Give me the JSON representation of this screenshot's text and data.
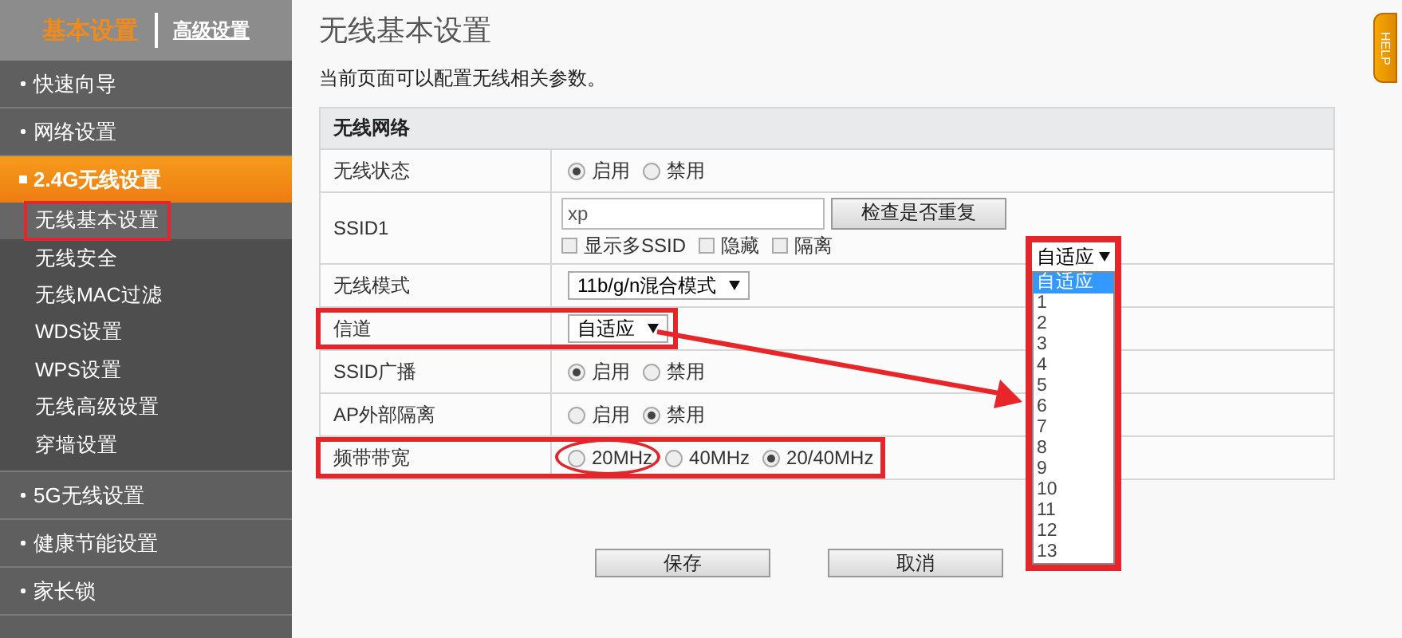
{
  "sidebar": {
    "tabs": [
      {
        "label": "基本设置",
        "selected": true
      },
      {
        "label": "高级设置",
        "selected": false
      }
    ],
    "items": [
      {
        "label": "快速向导",
        "expanded": false
      },
      {
        "label": "网络设置",
        "expanded": false
      },
      {
        "label": "2.4G无线设置",
        "expanded": true,
        "children": [
          {
            "label": "无线基本设置",
            "selected": true
          },
          {
            "label": "无线安全",
            "selected": false
          },
          {
            "label": "无线MAC过滤",
            "selected": false
          },
          {
            "label": "WDS设置",
            "selected": false
          },
          {
            "label": "WPS设置",
            "selected": false
          },
          {
            "label": "无线高级设置",
            "selected": false
          },
          {
            "label": "穿墙设置",
            "selected": false
          }
        ]
      },
      {
        "label": "5G无线设置",
        "expanded": false
      },
      {
        "label": "健康节能设置",
        "expanded": false
      },
      {
        "label": "家长锁",
        "expanded": false
      }
    ]
  },
  "page": {
    "title": "无线基本设置",
    "description": "当前页面可以配置无线相关参数。"
  },
  "form": {
    "section": "无线网络",
    "rows": [
      {
        "label": "无线状态",
        "kind": "radio",
        "highlighted": false,
        "options": [
          {
            "label": "启用",
            "selected": true
          },
          {
            "label": "禁用",
            "selected": false
          }
        ]
      },
      {
        "label": "SSID1",
        "kind": "ssid",
        "highlighted": false,
        "value": "xp",
        "button": "检查是否重复",
        "checkboxes": [
          {
            "label": "显示多SSID",
            "checked": false
          },
          {
            "label": "隐藏",
            "checked": false
          },
          {
            "label": "隔离",
            "checked": false
          }
        ]
      },
      {
        "label": "无线模式",
        "kind": "select",
        "highlighted": false,
        "value": "11b/g/n混合模式"
      },
      {
        "label": "信道",
        "kind": "select",
        "highlighted": true,
        "value": "自适应"
      },
      {
        "label": "SSID广播",
        "kind": "radio",
        "highlighted": false,
        "options": [
          {
            "label": "启用",
            "selected": true
          },
          {
            "label": "禁用",
            "selected": false
          }
        ]
      },
      {
        "label": "AP外部隔离",
        "kind": "radio",
        "highlighted": false,
        "options": [
          {
            "label": "启用",
            "selected": false
          },
          {
            "label": "禁用",
            "selected": true
          }
        ]
      },
      {
        "label": "频带带宽",
        "kind": "radio",
        "highlighted": true,
        "options": [
          {
            "label": "20MHz",
            "selected": false,
            "circled": true
          },
          {
            "label": "40MHz",
            "selected": false,
            "circled": false
          },
          {
            "label": "20/40MHz",
            "selected": true,
            "circled": false
          }
        ]
      }
    ]
  },
  "buttons": [
    "保存",
    "取消"
  ],
  "channel_dropdown": {
    "value": "自适应",
    "options": [
      {
        "label": "自适应",
        "selected": true
      },
      {
        "label": "1",
        "selected": false
      },
      {
        "label": "2",
        "selected": false
      },
      {
        "label": "3",
        "selected": false
      },
      {
        "label": "4",
        "selected": false
      },
      {
        "label": "5",
        "selected": false
      },
      {
        "label": "6",
        "selected": false
      },
      {
        "label": "7",
        "selected": false
      },
      {
        "label": "8",
        "selected": false
      },
      {
        "label": "9",
        "selected": false
      },
      {
        "label": "10",
        "selected": false
      },
      {
        "label": "11",
        "selected": false
      },
      {
        "label": "12",
        "selected": false
      },
      {
        "label": "13",
        "selected": false
      }
    ]
  },
  "help_tab": {
    "label": "HELP"
  }
}
